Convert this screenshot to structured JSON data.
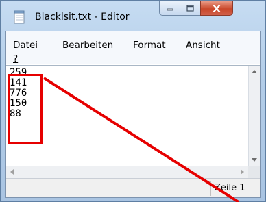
{
  "window": {
    "title": "Blacklsit.txt - Editor",
    "buttons": {
      "minimize": "—",
      "maximize": "□",
      "close": "✕"
    }
  },
  "menu": {
    "items": [
      {
        "label_ul": "D",
        "label_rest": "atei"
      },
      {
        "label_ul": "B",
        "label_rest": "earbeiten"
      },
      {
        "label_pre": "F",
        "label_ul": "o",
        "label_rest": "rmat"
      },
      {
        "label_ul": "A",
        "label_rest": "nsicht"
      },
      {
        "label_ul": "?",
        "label_rest": ""
      }
    ]
  },
  "editor": {
    "content": "259\n141\n776\n150\n88"
  },
  "statusbar": {
    "text": "Zeile 1"
  },
  "annotation": {
    "color": "#e60000"
  },
  "icons": [
    "notepad-icon",
    "minimize-icon",
    "maximize-icon",
    "close-icon",
    "scroll-up-icon",
    "scroll-down-icon",
    "scroll-left-icon",
    "scroll-right-icon"
  ]
}
